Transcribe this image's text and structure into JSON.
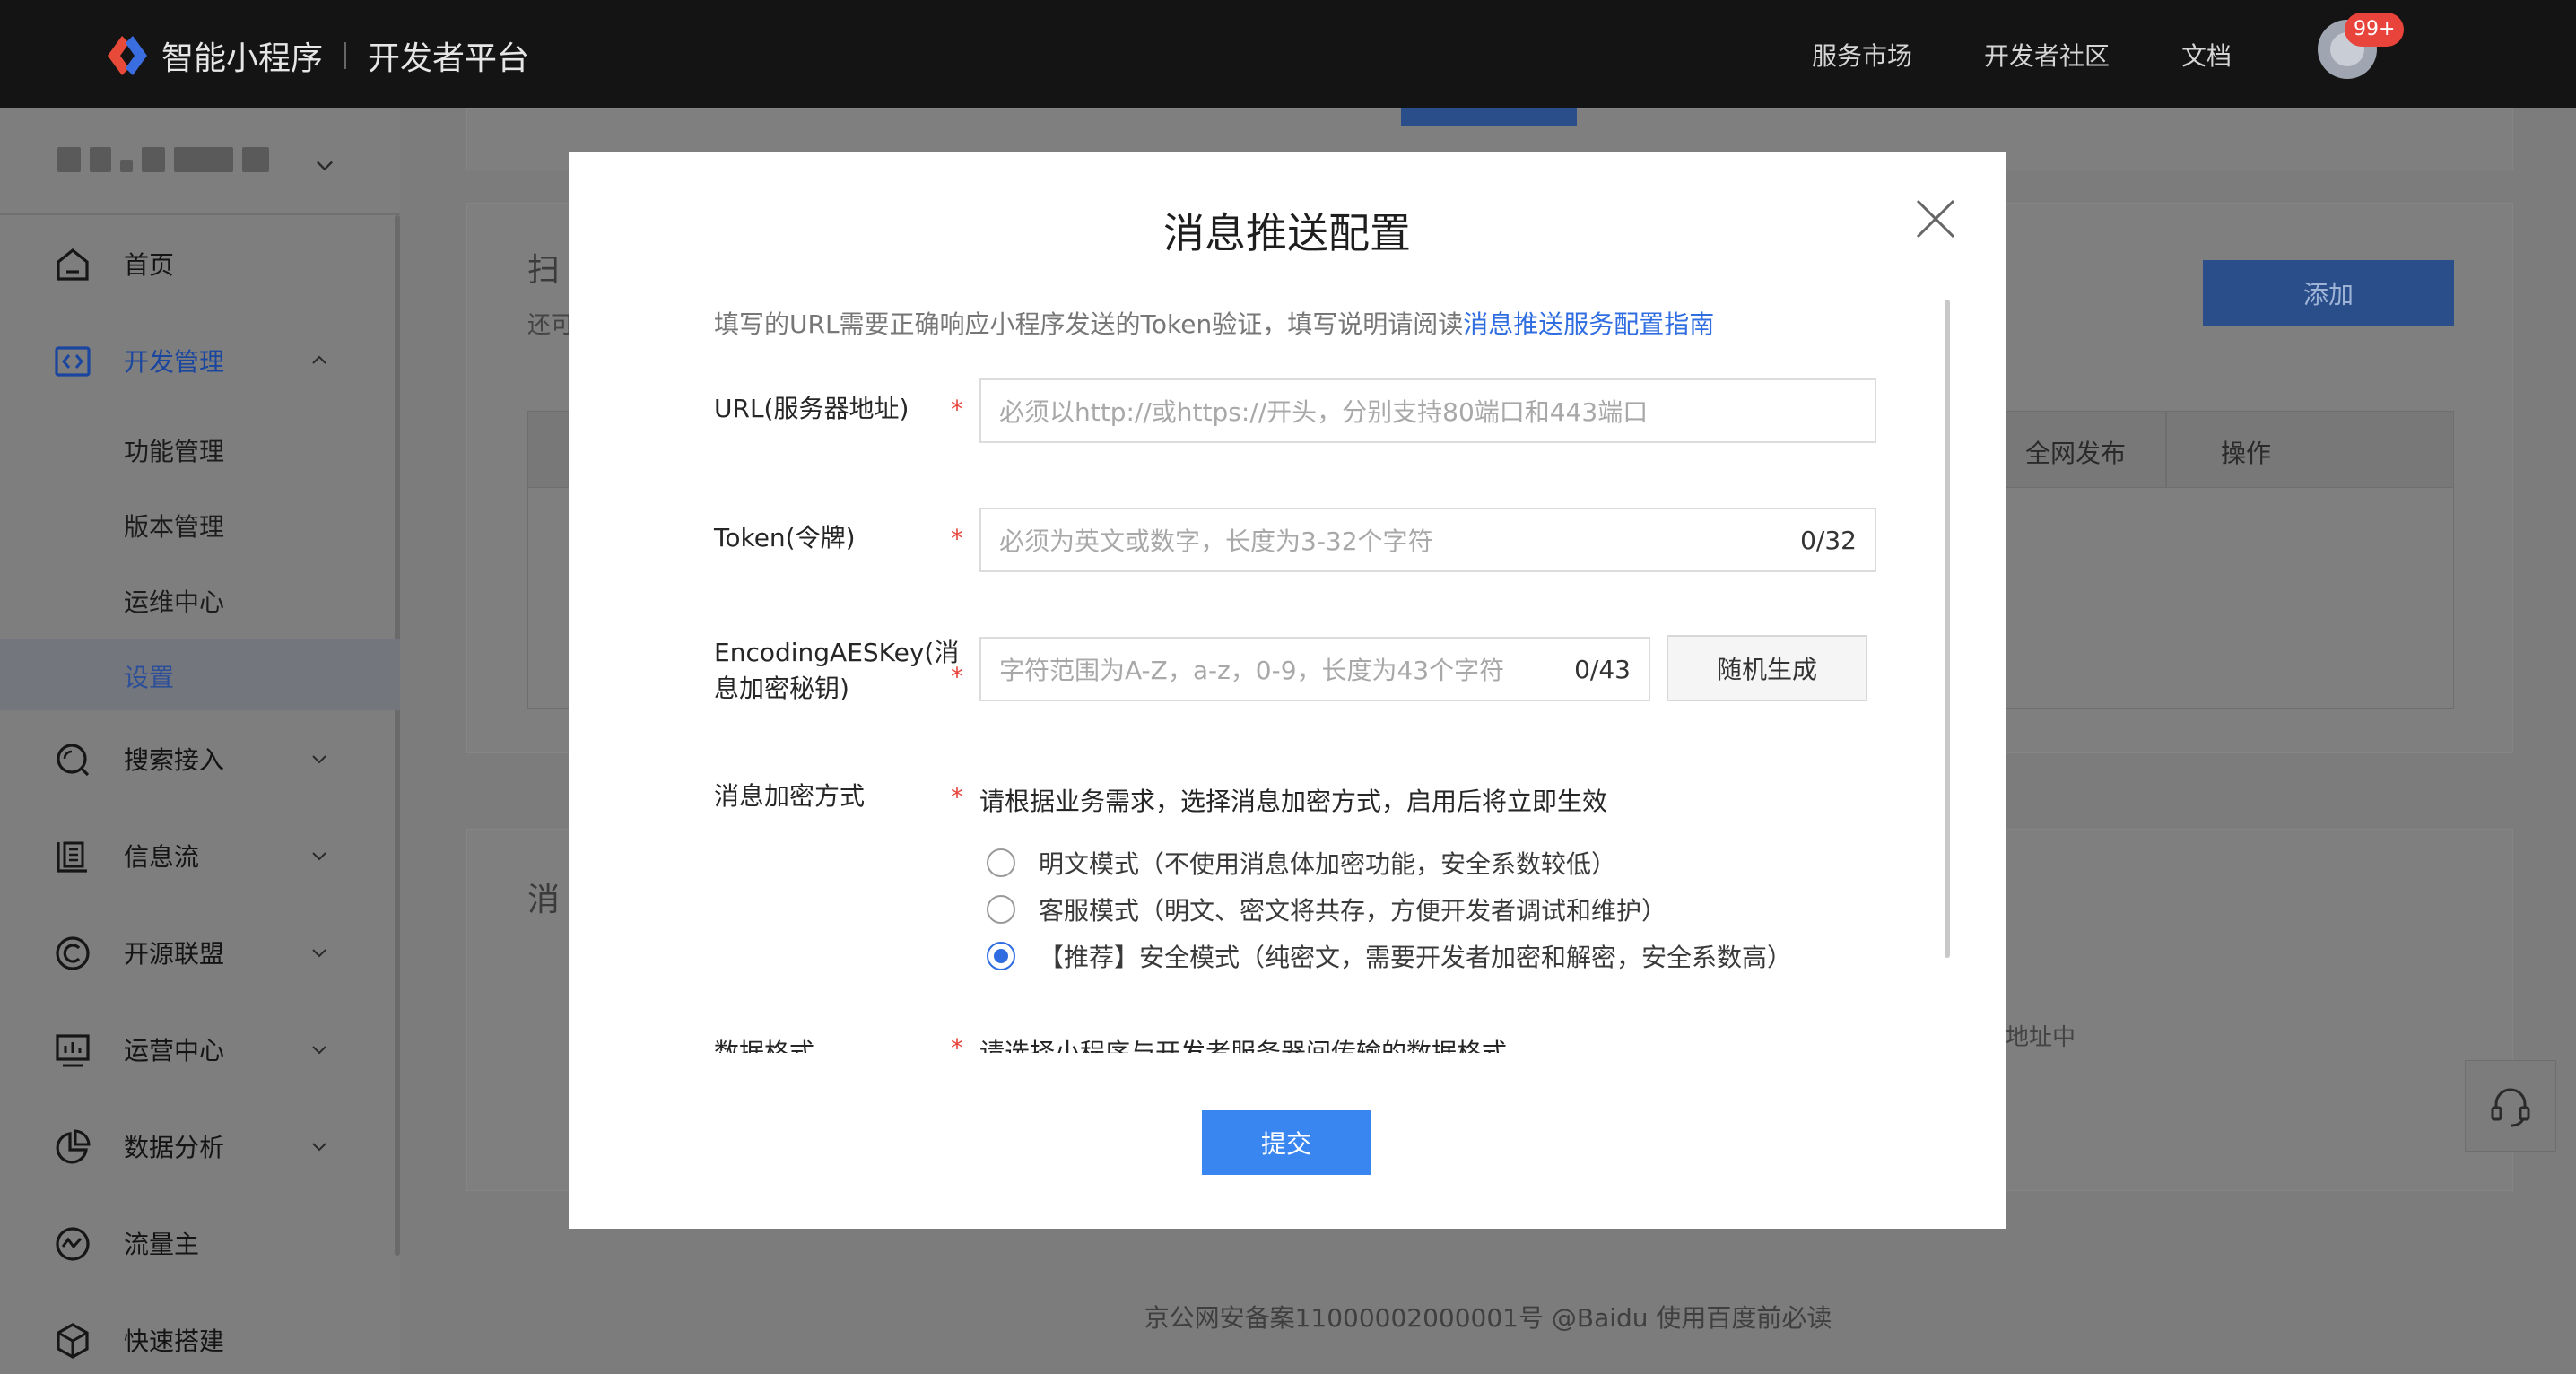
{
  "header": {
    "brand": "智能小程序",
    "platform": "开发者平台",
    "nav": [
      "服务市场",
      "开发者社区",
      "文档"
    ],
    "badge": "99+"
  },
  "sidebar": {
    "items": [
      {
        "label": "首页",
        "icon": "home-icon"
      },
      {
        "label": "开发管理",
        "icon": "code-icon",
        "expanded": true
      },
      {
        "label": "搜索接入",
        "icon": "search-icon"
      },
      {
        "label": "信息流",
        "icon": "feed-icon"
      },
      {
        "label": "开源联盟",
        "icon": "alliance-icon"
      },
      {
        "label": "运营中心",
        "icon": "operation-icon"
      },
      {
        "label": "数据分析",
        "icon": "chart-pie-icon"
      },
      {
        "label": "流量主",
        "icon": "traffic-icon"
      },
      {
        "label": "快速搭建",
        "icon": "cube-icon"
      }
    ],
    "sub_items": [
      "功能管理",
      "版本管理",
      "运维中心",
      "设置"
    ],
    "selected_sub": "设置"
  },
  "background": {
    "section1_title": "扫",
    "section1_sub": "还可",
    "add_button": "添加",
    "table_headers": [
      "全网发布",
      "操作"
    ],
    "section2_title": "消",
    "section2_tail": "地址中"
  },
  "modal": {
    "title": "消息推送配置",
    "desc_prefix": "填写的URL需要正确响应小程序发送的Token验证，填写说明请阅读",
    "desc_link": "消息推送服务配置指南",
    "url_label": "URL(服务器地址)",
    "url_placeholder": "必须以http://或https://开头，分别支持80端口和443端口",
    "token_label": "Token(令牌)",
    "token_placeholder": "必须为英文或数字，长度为3-32个字符",
    "token_count": "0/32",
    "aes_label_1": "EncodingAESKey(消",
    "aes_label_2": "息加密秘钥)",
    "aes_placeholder": "字符范围为A-Z，a-z，0-9，长度为43个字符",
    "aes_count": "0/43",
    "random_button": "随机生成",
    "encrypt_label": "消息加密方式",
    "encrypt_hint": "请根据业务需求，选择消息加密方式，启用后将立即生效",
    "encrypt_options": [
      {
        "label": "明文模式（不使用消息体加密功能，安全系数较低）",
        "checked": false
      },
      {
        "label": "客服模式（明文、密文将共存，方便开发者调试和维护）",
        "checked": false
      },
      {
        "label": "【推荐】安全模式（纯密文，需要开发者加密和解密，安全系数高）",
        "checked": true
      }
    ],
    "format_label": "数据格式",
    "format_hint": "请选择小程序与开发者服务器间传输的数据格式",
    "required_mark": "*",
    "submit": "提交"
  },
  "footer": "京公网安备案11000002000001号 @Baidu 使用百度前必读",
  "colors": {
    "accent": "#3a86f0",
    "link": "#2f6de1",
    "required": "#e8443b"
  }
}
